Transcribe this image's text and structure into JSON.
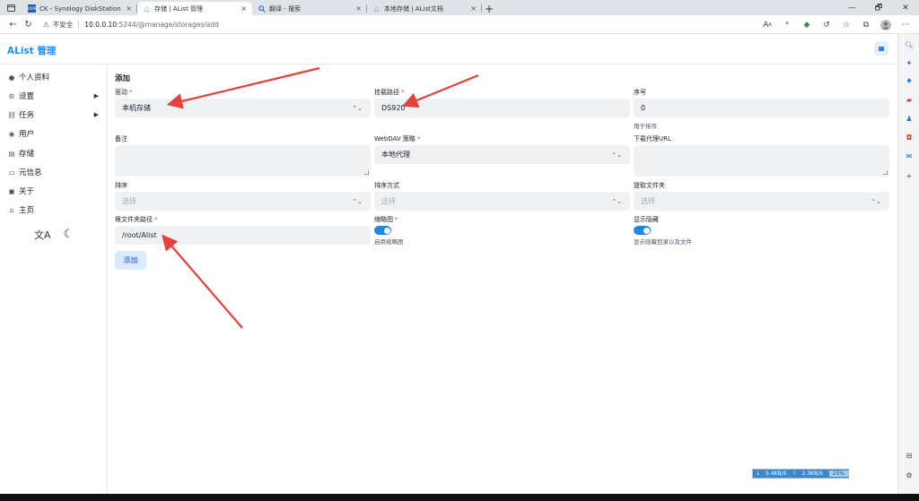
{
  "browser": {
    "tabs": [
      {
        "label": "CK - Synology DiskStation",
        "favicon": "DSM",
        "favicon_color": "#1e5fb4",
        "active": false
      },
      {
        "label": "存储 | AList 管理",
        "favicon": "△",
        "favicon_color": "#3ba5f4",
        "active": true
      },
      {
        "label": "翻译 - 搜索",
        "favicon": "🔍",
        "favicon_color": "#2f6fd1",
        "active": false
      },
      {
        "label": "本地存储 | AList文档",
        "favicon": "△",
        "favicon_color": "#3ba5f4",
        "active": false
      }
    ],
    "close_glyph": "×",
    "new_tab_glyph": "+",
    "window_controls": [
      "—",
      "🗗",
      "✕"
    ],
    "security_label": "不安全",
    "url_host": "10.0.0.10",
    "url_path": ":5244/@manage/storages/add"
  },
  "app": {
    "title": "AList 管理",
    "accent": "#1890ff"
  },
  "sidebar": {
    "items": [
      {
        "label": "个人资料",
        "icon": "user-circle-icon",
        "glyph": "●",
        "has_arrow": false
      },
      {
        "label": "设置",
        "icon": "gear-icon",
        "glyph": "⚙",
        "has_arrow": true
      },
      {
        "label": "任务",
        "icon": "tasks-icon",
        "glyph": "⛓",
        "has_arrow": true
      },
      {
        "label": "用户",
        "icon": "person-icon",
        "glyph": "◉",
        "has_arrow": false
      },
      {
        "label": "存储",
        "icon": "database-icon",
        "glyph": "▤",
        "has_arrow": false
      },
      {
        "label": "元信息",
        "icon": "meta-icon",
        "glyph": "▭",
        "has_arrow": false
      },
      {
        "label": "关于",
        "icon": "chat-icon",
        "glyph": "◼",
        "has_arrow": false
      },
      {
        "label": "主页",
        "icon": "home-icon",
        "glyph": "⌂",
        "has_arrow": false
      }
    ],
    "arrow_glyph": "▶",
    "translate_glyph": "文A",
    "theme_glyph": "☾"
  },
  "page": {
    "title": "添加"
  },
  "form": {
    "driver": {
      "label": "驱动",
      "value": "本机存储",
      "required": true
    },
    "mount_path": {
      "label": "挂载路径",
      "value": "DS920",
      "required": true
    },
    "order": {
      "label": "序号",
      "value": "0",
      "help": "用于排序"
    },
    "remark": {
      "label": "备注",
      "value": ""
    },
    "webdav_policy": {
      "label": "WebDAV 策略",
      "value": "本地代理",
      "required": true
    },
    "download_proxy_url": {
      "label": "下载代理URL",
      "value": ""
    },
    "order_by": {
      "label": "排序",
      "placeholder": "选择"
    },
    "order_direction": {
      "label": "排序方式",
      "placeholder": "选择"
    },
    "extract_folder": {
      "label": "提取文件夹",
      "placeholder": "选择"
    },
    "root_folder_path": {
      "label": "根文件夹路径",
      "value": "/root/Alist",
      "required": true
    },
    "thumbnail": {
      "label": "缩略图",
      "enabled": true,
      "help": "启用缩略图",
      "required": true
    },
    "show_hidden": {
      "label": "显示隐藏",
      "enabled": true,
      "help": "显示隐藏目录以及文件"
    },
    "required_mark": "*",
    "select_chevron": "⌃⌄",
    "submit_label": "添加"
  },
  "network_monitor": {
    "down": "5.4KB/S",
    "up": "2.3KB/S",
    "percent": "25%"
  },
  "annotation_color": "#e8403a"
}
